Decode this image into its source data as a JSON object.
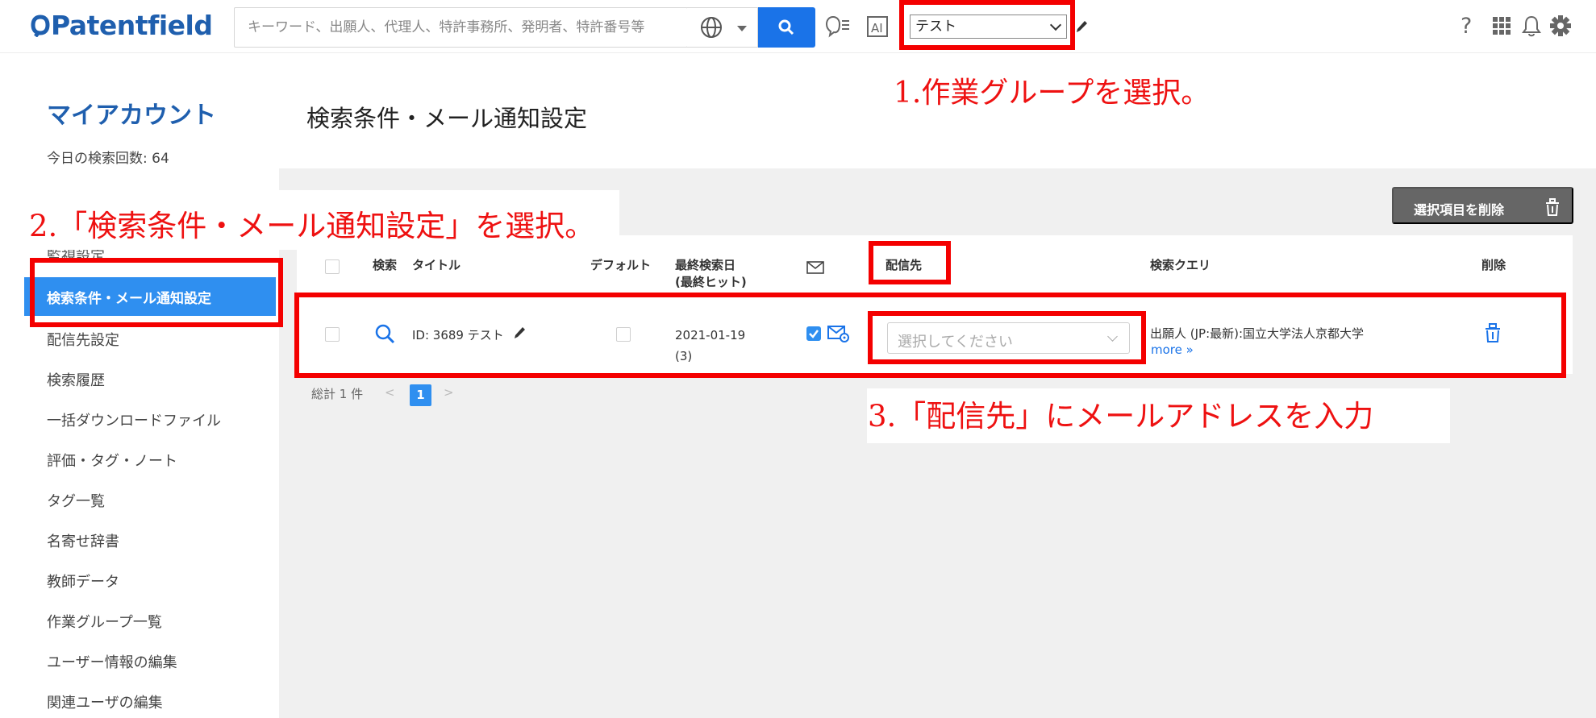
{
  "header": {
    "logo": "Patentfield",
    "search_placeholder": "キーワード、出願人、代理人、特許事務所、発明者、特許番号等",
    "work_group_value": "テスト",
    "icons": [
      "globe-icon",
      "search-icon",
      "chat-list-icon",
      "ai-icon",
      "pencil-icon",
      "help-icon",
      "apps-grid-icon",
      "bell-icon",
      "gear-icon"
    ]
  },
  "sidebar": {
    "title": "マイアカウント",
    "subtitle": "今日の検索回数: 64",
    "partial_item": "監視設定",
    "active_item": "検索条件・メール通知設定",
    "items": [
      "配信先設定",
      "検索履歴",
      "一括ダウンロードファイル",
      "評価・タグ・ノート",
      "タグ一覧",
      "名寄せ辞書",
      "教師データ",
      "作業グループ一覧",
      "ユーザー情報の編集",
      "関連ユーザの編集"
    ]
  },
  "main": {
    "title": "検索条件・メール通知設定",
    "delete_selected": "選択項目を削除",
    "columns": {
      "search": "検索",
      "title": "タイトル",
      "default": "デフォルト",
      "last_search_1": "最終検索日",
      "last_search_2": "(最終ヒット)",
      "destination": "配信先",
      "query": "検索クエリ",
      "delete": "削除"
    },
    "row": {
      "title": "ID: 3689  テスト",
      "date": "2021-01-19",
      "hits": "(3)",
      "destination_placeholder": "選択してください",
      "query": "出願人 (JP:最新):国立大学法人京都大学",
      "more": "more »"
    },
    "pagination": {
      "total": "総計 1 件",
      "current_page": "1"
    }
  },
  "annotations": {
    "step1": "1.作業グループを選択。",
    "step2": "2.「検索条件・メール通知設定」を選択。",
    "step3": "3.「配信先」にメールアドレスを入力"
  },
  "colors": {
    "brand": "#1f5fae",
    "accent": "#2f8ff0",
    "search_button": "#1a73e8",
    "highlight": "#f40000"
  }
}
